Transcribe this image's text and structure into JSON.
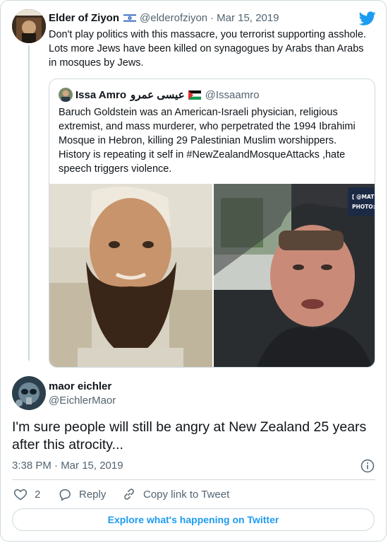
{
  "original_tweet": {
    "display_name": "Elder of Ziyon",
    "flag_icon": "israel-flag-icon",
    "handle": "@elderofziyon",
    "separator": "·",
    "date": "Mar 15, 2019",
    "text": "Don't play politics with this massacre, you terrorist supporting asshole.  Lots more Jews have been killed on synagogues by Arabs than Arabs in mosques by Jews."
  },
  "quoted_tweet": {
    "display_name": "Issa Amro",
    "arabic_name": "عيسى عمرو",
    "flag_icon": "palestine-flag-icon",
    "handle": "@Issaamro",
    "text": "Baruch Goldstein was an American-Israeli physician, religious extremist, and mass murderer, who perpetrated the 1994 Ibrahimi Mosque in Hebron, killing 29 Palestinian Muslim worshippers. History is repeating it self in #NewZealandMosqueAttacks ,hate speech triggers violence.",
    "photo_overlay_line1": "[ @MAT",
    "photo_overlay_line2": "PHOTO:"
  },
  "reply_tweet": {
    "display_name": "maor eichler",
    "handle": "@EichlerMaor",
    "text": "I'm sure people will still be angry at New Zealand 25 years after this atrocity...",
    "timestamp": "3:38 PM · Mar 15, 2019"
  },
  "actions": {
    "like_count": "2",
    "reply_label": "Reply",
    "copy_link_label": "Copy link to Tweet"
  },
  "explore_label": "Explore what's happening on Twitter",
  "colors": {
    "twitter_blue": "#1d9bf0",
    "text_primary": "#0f1419",
    "text_secondary": "#536471",
    "border": "#cfd9de"
  }
}
